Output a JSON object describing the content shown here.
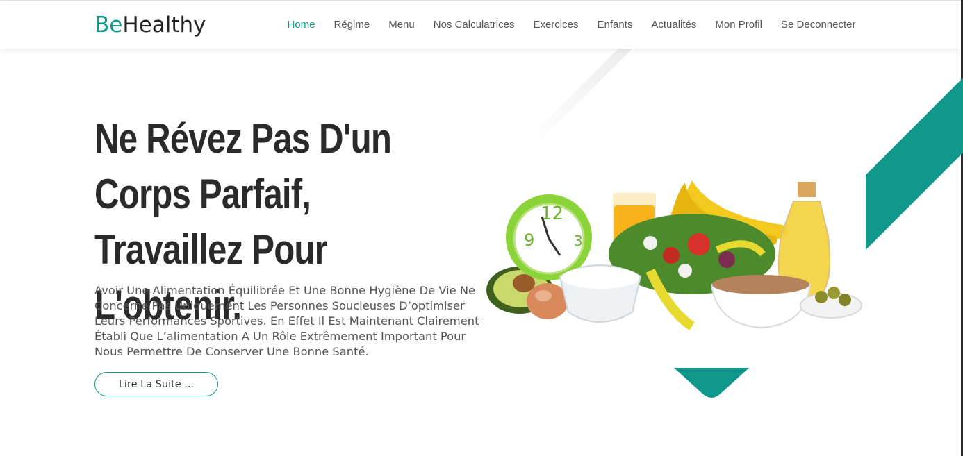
{
  "brand": {
    "prefix": "Be",
    "suffix": "Healthy"
  },
  "nav": {
    "items": [
      {
        "label": "Home"
      },
      {
        "label": "Régime"
      },
      {
        "label": "Menu"
      },
      {
        "label": "Nos Calculatrices"
      },
      {
        "label": "Exercices"
      },
      {
        "label": "Enfants"
      },
      {
        "label": "Actualités"
      },
      {
        "label": "Mon Profil"
      },
      {
        "label": "Se Deconnecter"
      }
    ]
  },
  "hero": {
    "title": "Ne Révez Pas D'un Corps Parfaif, Travaillez Pour L'obtenir.",
    "text": "Avoir Une Alimentation Équilibrée Et Une Bonne Hygiène De Vie Ne Concerne Pas Uniquement Les Personnes Soucieuses D’optimiser Leurs Performances Sportives. En Effet Il Est Maintenant Clairement Établi Que L’alimentation A Un Rôle Extrêmement Important Pour Nous Permettre De Conserver Une Bonne Santé.",
    "cta_label": "Lire La Suite ..."
  },
  "colors": {
    "accent": "#10988a",
    "heading": "#2a2a2a",
    "text": "#555555"
  }
}
